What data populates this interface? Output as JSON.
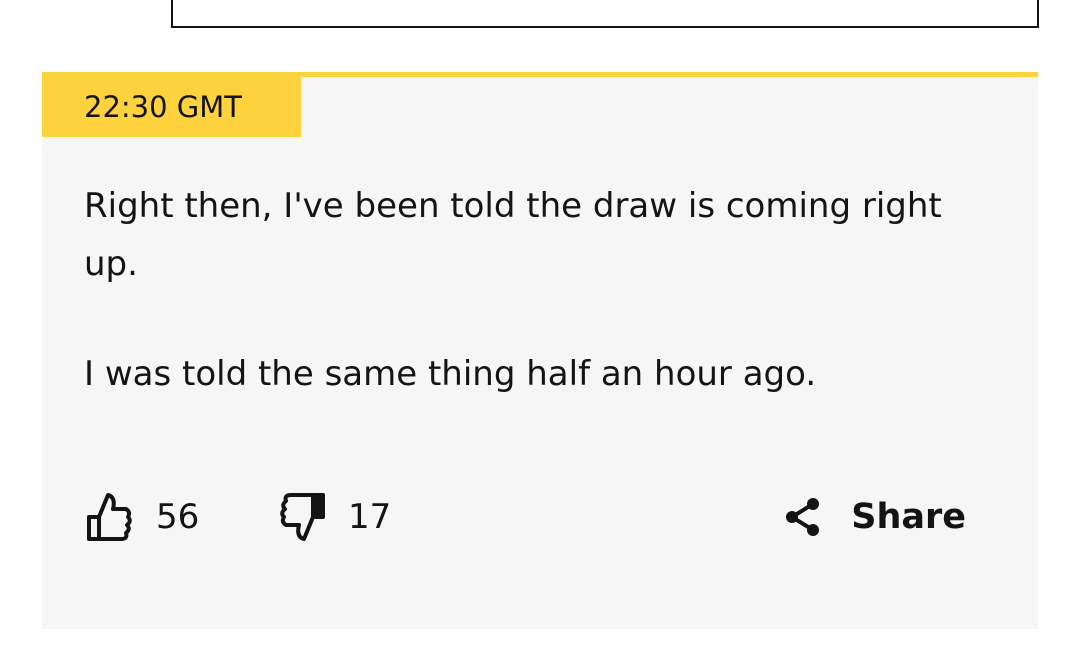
{
  "post": {
    "timestamp": "22:30 GMT",
    "paragraphs": [
      "Right then, I've been told the draw is coming right up.",
      "I was told the same thing half an hour ago."
    ],
    "likes": "56",
    "dislikes": "17",
    "share_label": "Share"
  },
  "colors": {
    "accent": "#fed23c",
    "panel_background": "#f6f6f6",
    "text": "#141414"
  },
  "icons": {
    "like": "thumbs-up-icon",
    "dislike": "thumbs-down-icon",
    "share": "share-icon"
  }
}
